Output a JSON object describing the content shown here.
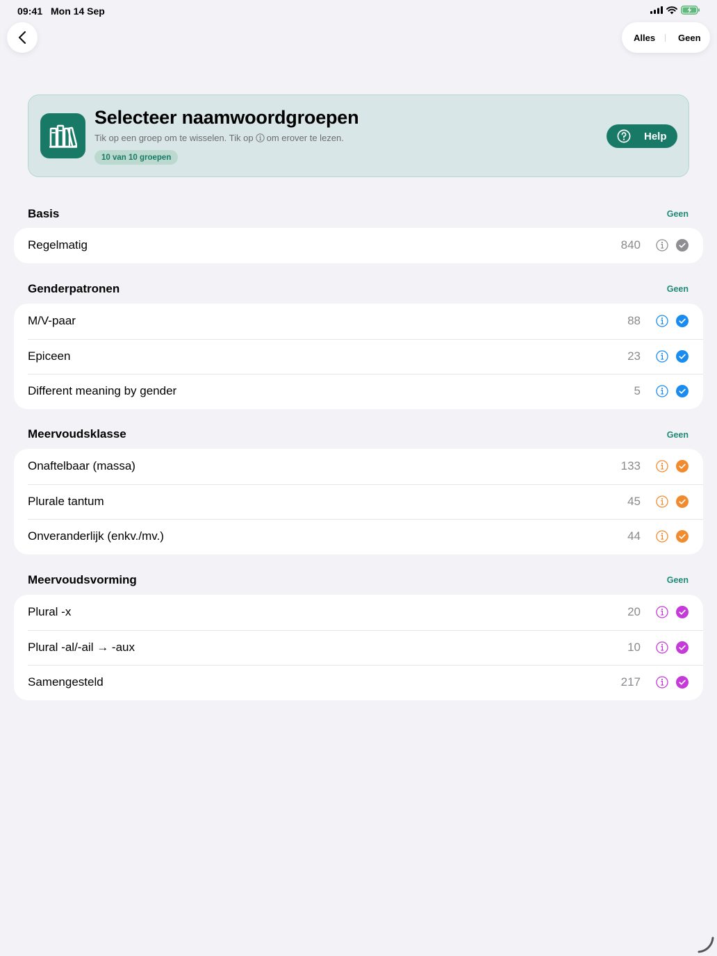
{
  "status_bar": {
    "time": "09:41",
    "date": "Mon 14 Sep"
  },
  "nav": {
    "back_icon": "chevron-left-icon",
    "select_all": "Alles",
    "select_none": "Geen"
  },
  "header": {
    "title": "Selecteer naamwoordgroepen",
    "subtitle_before": "Tik op een groep om te wisselen. Tik op",
    "subtitle_after": "om erover te lezen.",
    "badge": "10 van 10 groepen",
    "help_label": "Help",
    "icon": "books-icon",
    "accent": "#187a66"
  },
  "sections": [
    {
      "title": "Basis",
      "none_label": "Geen",
      "color": "#8e8e93",
      "items": [
        {
          "label": "Regelmatig",
          "count": "840"
        }
      ]
    },
    {
      "title": "Genderpatronen",
      "none_label": "Geen",
      "color": "#1a8cf0",
      "items": [
        {
          "label": "M/V-paar",
          "count": "88"
        },
        {
          "label": "Epiceen",
          "count": "23"
        },
        {
          "label": "Different meaning by gender",
          "count": "5"
        }
      ]
    },
    {
      "title": "Meervoudsklasse",
      "none_label": "Geen",
      "color": "#f28a2e",
      "items": [
        {
          "label": "Onaftelbaar (massa)",
          "count": "133"
        },
        {
          "label": "Plurale tantum",
          "count": "45"
        },
        {
          "label": "Onveranderlijk (enkv./mv.)",
          "count": "44"
        }
      ]
    },
    {
      "title": "Meervoudsvorming",
      "none_label": "Geen",
      "color": "#c53ad8",
      "items": [
        {
          "label": "Plural -x",
          "count": "20"
        },
        {
          "label": "Plural -al/-ail → -aux",
          "count": "10"
        },
        {
          "label": "Samengesteld",
          "count": "217"
        }
      ]
    }
  ]
}
